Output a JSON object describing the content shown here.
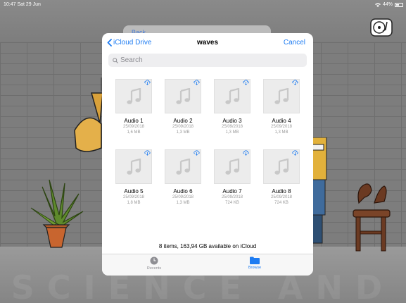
{
  "status_bar": {
    "time_date": "10:47  Sat 29 Jun",
    "battery": "44%",
    "battery_level": 0.44
  },
  "background_sheet": {
    "back_label": "Back"
  },
  "picker": {
    "back_label": "iCloud Drive",
    "title": "waves",
    "cancel_label": "Cancel",
    "search_placeholder": "Search",
    "files": [
      {
        "name": "Audio 1",
        "date": "25/09/2018",
        "size": "1,6 MB"
      },
      {
        "name": "Audio 2",
        "date": "25/09/2018",
        "size": "1,3 MB"
      },
      {
        "name": "Audio 3",
        "date": "25/09/2018",
        "size": "1,3 MB"
      },
      {
        "name": "Audio 4",
        "date": "25/09/2018",
        "size": "1,3 MB"
      },
      {
        "name": "Audio 5",
        "date": "25/09/2018",
        "size": "1,8 MB"
      },
      {
        "name": "Audio 6",
        "date": "25/09/2018",
        "size": "1,3 MB"
      },
      {
        "name": "Audio 7",
        "date": "25/09/2018",
        "size": "724 KB"
      },
      {
        "name": "Audio 8",
        "date": "25/09/2018",
        "size": "724 KB"
      }
    ],
    "storage_info": "8 items, 163,94 GB available on iCloud",
    "tabs": {
      "recents": "Recents",
      "browse": "Browse"
    }
  },
  "watermark": "SCIENCE AND TECHNOLOGY PUBLICATIONS",
  "colors": {
    "accent": "#1e7cf2",
    "secondary_text": "#9a9a9a",
    "tab_inactive": "#8e8e93"
  },
  "icons": [
    "music-note-icon",
    "cloud-download-icon",
    "chevron-left-icon",
    "clock-icon",
    "folder-icon",
    "turntable-icon",
    "wifi-icon",
    "battery-icon"
  ]
}
